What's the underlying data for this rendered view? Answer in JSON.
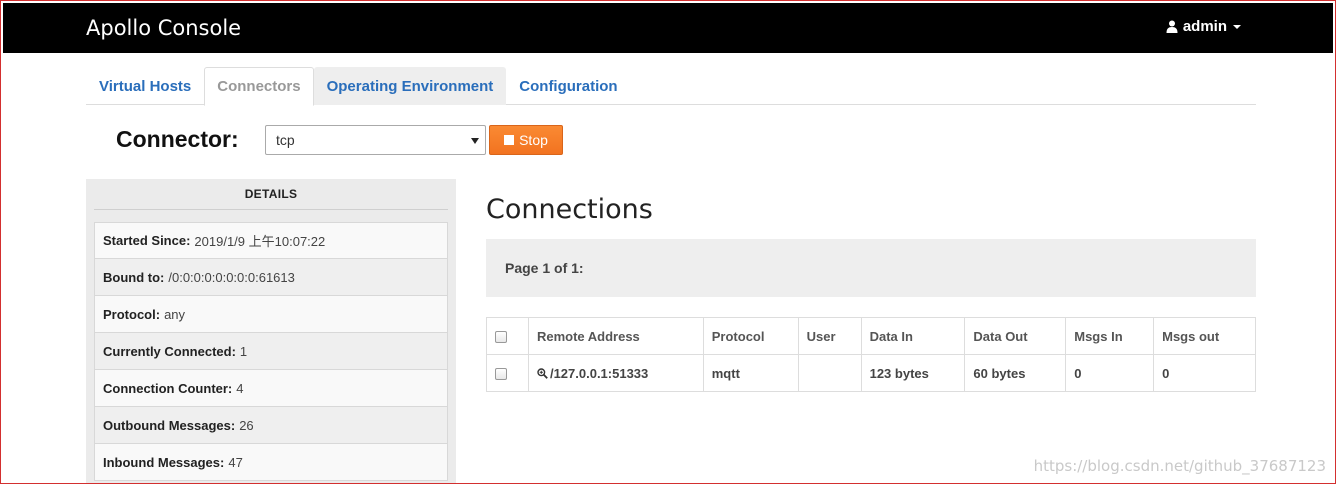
{
  "navbar": {
    "brand": "Apollo Console",
    "user_label": "admin",
    "user_icon": "user-icon"
  },
  "tabs": [
    {
      "label": "Virtual Hosts",
      "active": false
    },
    {
      "label": "Connectors",
      "active": true
    },
    {
      "label": "Operating Environment",
      "active": false
    },
    {
      "label": "Configuration",
      "active": false
    }
  ],
  "connector": {
    "label": "Connector:",
    "selected": "tcp",
    "stop_label": "Stop"
  },
  "details": {
    "title": "DETAILS",
    "rows": [
      {
        "key": "Started Since:",
        "value": "2019/1/9 上午10:07:22"
      },
      {
        "key": "Bound to:",
        "value": "/0:0:0:0:0:0:0:0:61613"
      },
      {
        "key": "Protocol:",
        "value": "any"
      },
      {
        "key": "Currently Connected:",
        "value": "1"
      },
      {
        "key": "Connection Counter:",
        "value": "4"
      },
      {
        "key": "Outbound Messages:",
        "value": "26"
      },
      {
        "key": "Inbound Messages:",
        "value": "47"
      }
    ]
  },
  "connections": {
    "title": "Connections",
    "page_info": "Page 1 of 1:",
    "columns": [
      "Remote Address",
      "Protocol",
      "User",
      "Data In",
      "Data Out",
      "Msgs In",
      "Msgs out"
    ],
    "rows": [
      {
        "remote": "/127.0.0.1:51333",
        "protocol": "mqtt",
        "user": "",
        "data_in": "123 bytes",
        "data_out": "60 bytes",
        "msgs_in": "0",
        "msgs_out": "0"
      }
    ]
  },
  "watermark": "https://blog.csdn.net/github_37687123",
  "colors": {
    "navbar_bg": "#000000",
    "tab_link": "#2a6ebb",
    "stop_button": "#f27320",
    "panel_bg": "#ebebeb"
  }
}
